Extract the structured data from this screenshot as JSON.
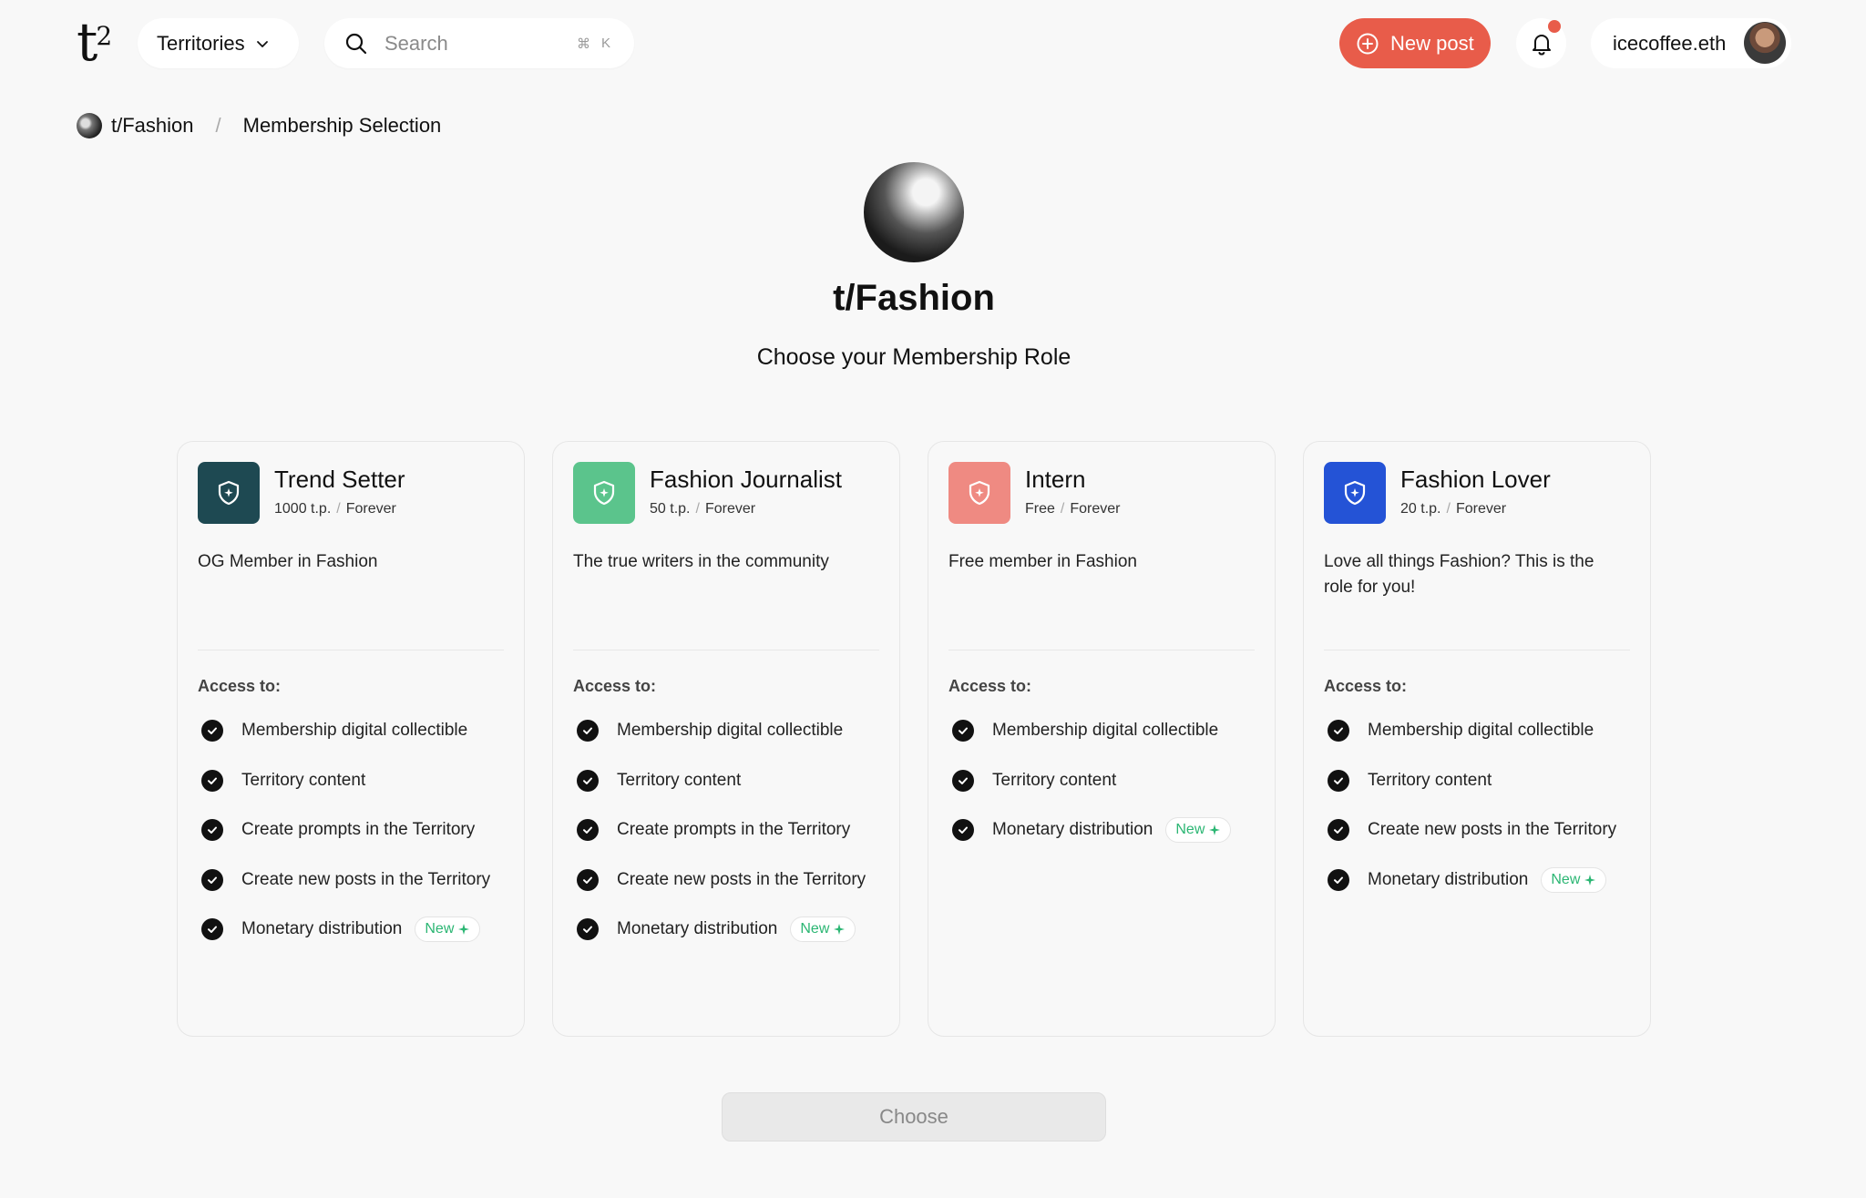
{
  "header": {
    "logo_text": "t",
    "logo_sup": "2",
    "territories_label": "Territories",
    "search_placeholder": "Search",
    "search_shortcut_cmd": "⌘",
    "search_shortcut_key": "K",
    "new_post_label": "New post",
    "username": "icecoffee.eth"
  },
  "breadcrumb": {
    "territory": "t/Fashion",
    "separator": "/",
    "current": "Membership Selection"
  },
  "hero": {
    "title": "t/Fashion",
    "subtitle": "Choose your Membership Role"
  },
  "access_label": "Access to:",
  "new_label": "New",
  "roles": [
    {
      "name": "Trend Setter",
      "price": "1000 t.p.",
      "duration": "Forever",
      "description": "OG Member in Fashion",
      "color": "#1e4952",
      "perks": [
        {
          "text": "Membership digital collectible",
          "new": false
        },
        {
          "text": "Territory content",
          "new": false
        },
        {
          "text": "Create prompts in the Territory",
          "new": false
        },
        {
          "text": "Create new posts in the Territory",
          "new": false
        },
        {
          "text": "Monetary distribution",
          "new": true
        }
      ]
    },
    {
      "name": "Fashion Journalist",
      "price": "50 t.p.",
      "duration": "Forever",
      "description": "The true writers in the community",
      "color": "#5bc48c",
      "perks": [
        {
          "text": "Membership digital collectible",
          "new": false
        },
        {
          "text": "Territory content",
          "new": false
        },
        {
          "text": "Create prompts in the Territory",
          "new": false
        },
        {
          "text": "Create new posts in the Territory",
          "new": false
        },
        {
          "text": "Monetary distribution",
          "new": true
        }
      ]
    },
    {
      "name": "Intern",
      "price": "Free",
      "duration": "Forever",
      "description": "Free member in Fashion",
      "color": "#ef8a82",
      "perks": [
        {
          "text": "Membership digital collectible",
          "new": false
        },
        {
          "text": "Territory content",
          "new": false
        },
        {
          "text": "Monetary distribution",
          "new": true
        }
      ]
    },
    {
      "name": "Fashion Lover",
      "price": "20 t.p.",
      "duration": "Forever",
      "description": "Love all things Fashion? This is the role for you!",
      "color": "#2453d6",
      "perks": [
        {
          "text": "Membership digital collectible",
          "new": false
        },
        {
          "text": "Territory content",
          "new": false
        },
        {
          "text": "Create new posts in the Territory",
          "new": false
        },
        {
          "text": "Monetary distribution",
          "new": true
        }
      ]
    }
  ],
  "choose_label": "Choose",
  "colors": {
    "accent": "#e85c4a",
    "new_tag": "#2bb673"
  }
}
